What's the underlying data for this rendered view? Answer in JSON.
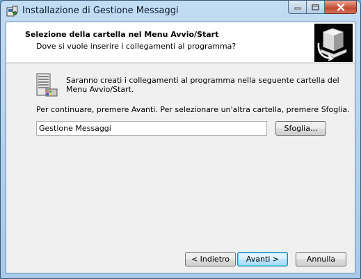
{
  "window": {
    "title": "Installazione di Gestione Messaggi",
    "icon": "installer-app-icon"
  },
  "caption_buttons": {
    "minimize": "minimize-icon",
    "maximize": "maximize-icon",
    "close": "close-icon"
  },
  "header": {
    "title": "Selezione della cartella nel Menu Avvio/Start",
    "subtitle": "Dove si vuole inserire i collegamenti al programma?",
    "icon": "computer-install-icon"
  },
  "body": {
    "icon": "program-folder-icon",
    "info": "Saranno creati i collegamenti al programma nella seguente cartella del Menu Avvio/Start.",
    "instruction": "Per continuare, premere Avanti. Per selezionare un'altra cartella, premere Sfoglia.",
    "folder_value": "Gestione Messaggi",
    "browse_label": "Sfoglia..."
  },
  "footer": {
    "back_label": "< Indietro",
    "next_label": "Avanti >",
    "cancel_label": "Annulla"
  },
  "colors": {
    "accent": "#3c7fb1",
    "close": "#c24a30",
    "frame": "#a8c9e8"
  }
}
